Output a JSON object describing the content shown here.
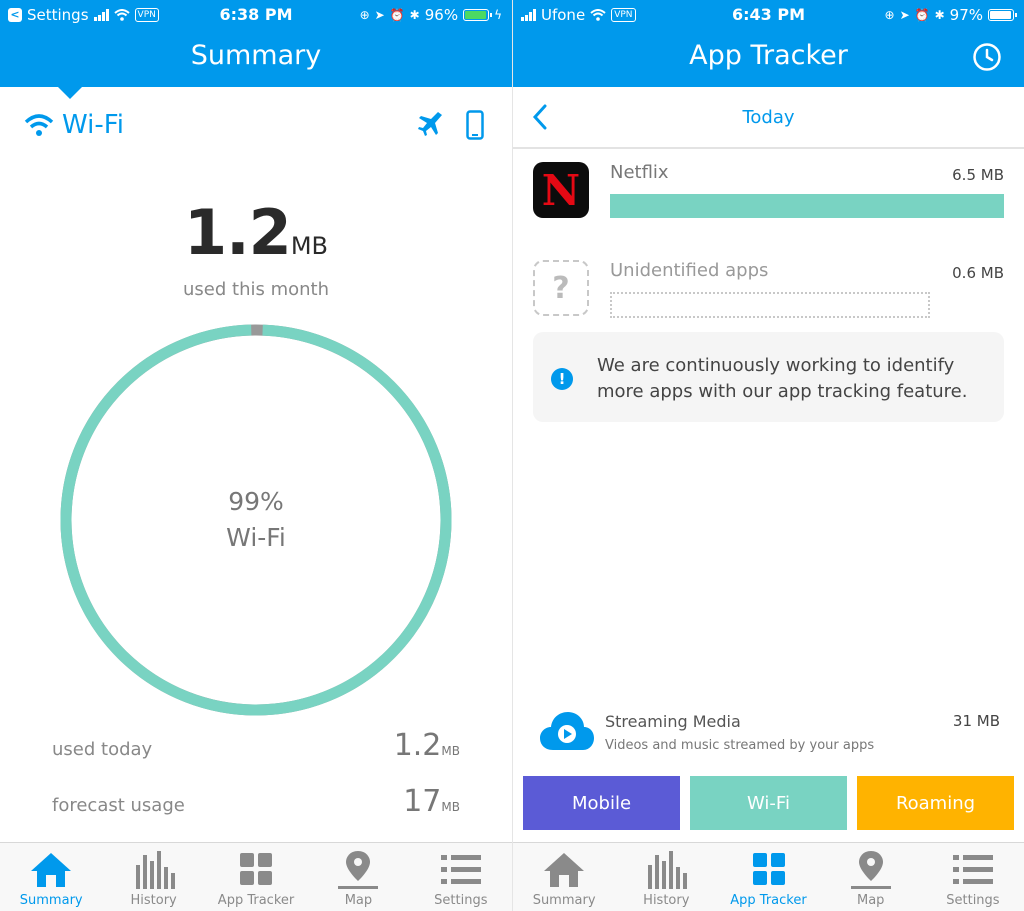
{
  "left": {
    "status": {
      "back_app": "Settings",
      "vpn": "VPN",
      "time": "6:38 PM",
      "battery": "96%"
    },
    "header": {
      "title": "Summary"
    },
    "wifi_label": "Wi-Fi",
    "usage": {
      "value": "1.2",
      "unit": "MB",
      "label": "used this month"
    },
    "ring": {
      "percent_text": "99%",
      "label": "Wi-Fi",
      "wifi_fraction": 0.99,
      "color": "#79d3c2",
      "other_color": "#999999"
    },
    "stats": [
      {
        "label": "used today",
        "value": "1.2",
        "unit": "MB"
      },
      {
        "label": "forecast usage",
        "value": "17",
        "unit": "MB"
      }
    ]
  },
  "right": {
    "status": {
      "carrier": "Ufone",
      "vpn": "VPN",
      "time": "6:43 PM",
      "battery": "97%"
    },
    "header": {
      "title": "App Tracker"
    },
    "period": "Today",
    "apps": [
      {
        "name": "Netflix",
        "icon_letter": "N",
        "size": "6.5 MB",
        "fraction": 1.0
      },
      {
        "name": "Unidentified apps",
        "icon_letter": "?",
        "size": "0.6 MB"
      }
    ],
    "info_message": "We are continuously working to identify more apps with our app tracking feature.",
    "streaming": {
      "title": "Streaming Media",
      "subtitle": "Videos and music streamed by your apps",
      "size": "31 MB"
    },
    "segments": [
      {
        "label": "Mobile",
        "color": "#5b5bd6"
      },
      {
        "label": "Wi-Fi",
        "color": "#79d3c2"
      },
      {
        "label": "Roaming",
        "color": "#ffb300"
      }
    ]
  },
  "tabs": [
    {
      "label": "Summary",
      "icon": "home-icon"
    },
    {
      "label": "History",
      "icon": "bar-chart-icon"
    },
    {
      "label": "App Tracker",
      "icon": "grid-icon"
    },
    {
      "label": "Map",
      "icon": "map-pin-icon"
    },
    {
      "label": "Settings",
      "icon": "list-icon"
    }
  ],
  "colors": {
    "brand": "#0099ec",
    "teal": "#79d3c2",
    "tab_inactive": "#8a8a8a"
  }
}
